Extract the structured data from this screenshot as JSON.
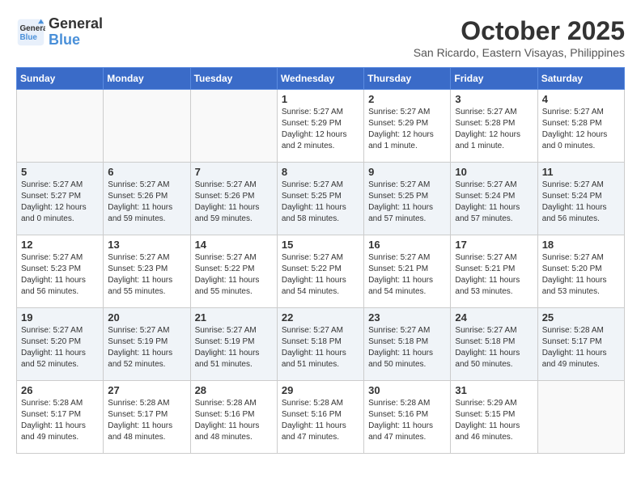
{
  "header": {
    "logo_line1": "General",
    "logo_line2": "Blue",
    "month": "October 2025",
    "location": "San Ricardo, Eastern Visayas, Philippines"
  },
  "weekdays": [
    "Sunday",
    "Monday",
    "Tuesday",
    "Wednesday",
    "Thursday",
    "Friday",
    "Saturday"
  ],
  "weeks": [
    [
      {
        "day": "",
        "info": ""
      },
      {
        "day": "",
        "info": ""
      },
      {
        "day": "",
        "info": ""
      },
      {
        "day": "1",
        "info": "Sunrise: 5:27 AM\nSunset: 5:29 PM\nDaylight: 12 hours\nand 2 minutes."
      },
      {
        "day": "2",
        "info": "Sunrise: 5:27 AM\nSunset: 5:29 PM\nDaylight: 12 hours\nand 1 minute."
      },
      {
        "day": "3",
        "info": "Sunrise: 5:27 AM\nSunset: 5:28 PM\nDaylight: 12 hours\nand 1 minute."
      },
      {
        "day": "4",
        "info": "Sunrise: 5:27 AM\nSunset: 5:28 PM\nDaylight: 12 hours\nand 0 minutes."
      }
    ],
    [
      {
        "day": "5",
        "info": "Sunrise: 5:27 AM\nSunset: 5:27 PM\nDaylight: 12 hours\nand 0 minutes."
      },
      {
        "day": "6",
        "info": "Sunrise: 5:27 AM\nSunset: 5:26 PM\nDaylight: 11 hours\nand 59 minutes."
      },
      {
        "day": "7",
        "info": "Sunrise: 5:27 AM\nSunset: 5:26 PM\nDaylight: 11 hours\nand 59 minutes."
      },
      {
        "day": "8",
        "info": "Sunrise: 5:27 AM\nSunset: 5:25 PM\nDaylight: 11 hours\nand 58 minutes."
      },
      {
        "day": "9",
        "info": "Sunrise: 5:27 AM\nSunset: 5:25 PM\nDaylight: 11 hours\nand 57 minutes."
      },
      {
        "day": "10",
        "info": "Sunrise: 5:27 AM\nSunset: 5:24 PM\nDaylight: 11 hours\nand 57 minutes."
      },
      {
        "day": "11",
        "info": "Sunrise: 5:27 AM\nSunset: 5:24 PM\nDaylight: 11 hours\nand 56 minutes."
      }
    ],
    [
      {
        "day": "12",
        "info": "Sunrise: 5:27 AM\nSunset: 5:23 PM\nDaylight: 11 hours\nand 56 minutes."
      },
      {
        "day": "13",
        "info": "Sunrise: 5:27 AM\nSunset: 5:23 PM\nDaylight: 11 hours\nand 55 minutes."
      },
      {
        "day": "14",
        "info": "Sunrise: 5:27 AM\nSunset: 5:22 PM\nDaylight: 11 hours\nand 55 minutes."
      },
      {
        "day": "15",
        "info": "Sunrise: 5:27 AM\nSunset: 5:22 PM\nDaylight: 11 hours\nand 54 minutes."
      },
      {
        "day": "16",
        "info": "Sunrise: 5:27 AM\nSunset: 5:21 PM\nDaylight: 11 hours\nand 54 minutes."
      },
      {
        "day": "17",
        "info": "Sunrise: 5:27 AM\nSunset: 5:21 PM\nDaylight: 11 hours\nand 53 minutes."
      },
      {
        "day": "18",
        "info": "Sunrise: 5:27 AM\nSunset: 5:20 PM\nDaylight: 11 hours\nand 53 minutes."
      }
    ],
    [
      {
        "day": "19",
        "info": "Sunrise: 5:27 AM\nSunset: 5:20 PM\nDaylight: 11 hours\nand 52 minutes."
      },
      {
        "day": "20",
        "info": "Sunrise: 5:27 AM\nSunset: 5:19 PM\nDaylight: 11 hours\nand 52 minutes."
      },
      {
        "day": "21",
        "info": "Sunrise: 5:27 AM\nSunset: 5:19 PM\nDaylight: 11 hours\nand 51 minutes."
      },
      {
        "day": "22",
        "info": "Sunrise: 5:27 AM\nSunset: 5:18 PM\nDaylight: 11 hours\nand 51 minutes."
      },
      {
        "day": "23",
        "info": "Sunrise: 5:27 AM\nSunset: 5:18 PM\nDaylight: 11 hours\nand 50 minutes."
      },
      {
        "day": "24",
        "info": "Sunrise: 5:27 AM\nSunset: 5:18 PM\nDaylight: 11 hours\nand 50 minutes."
      },
      {
        "day": "25",
        "info": "Sunrise: 5:28 AM\nSunset: 5:17 PM\nDaylight: 11 hours\nand 49 minutes."
      }
    ],
    [
      {
        "day": "26",
        "info": "Sunrise: 5:28 AM\nSunset: 5:17 PM\nDaylight: 11 hours\nand 49 minutes."
      },
      {
        "day": "27",
        "info": "Sunrise: 5:28 AM\nSunset: 5:17 PM\nDaylight: 11 hours\nand 48 minutes."
      },
      {
        "day": "28",
        "info": "Sunrise: 5:28 AM\nSunset: 5:16 PM\nDaylight: 11 hours\nand 48 minutes."
      },
      {
        "day": "29",
        "info": "Sunrise: 5:28 AM\nSunset: 5:16 PM\nDaylight: 11 hours\nand 47 minutes."
      },
      {
        "day": "30",
        "info": "Sunrise: 5:28 AM\nSunset: 5:16 PM\nDaylight: 11 hours\nand 47 minutes."
      },
      {
        "day": "31",
        "info": "Sunrise: 5:29 AM\nSunset: 5:15 PM\nDaylight: 11 hours\nand 46 minutes."
      },
      {
        "day": "",
        "info": ""
      }
    ]
  ]
}
